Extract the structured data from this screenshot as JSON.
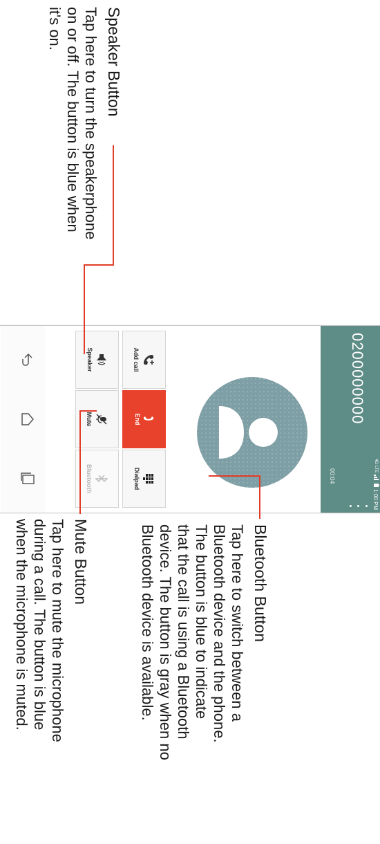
{
  "annotations": {
    "speaker": {
      "title": "Speaker Button",
      "body": [
        "Tap here to turn the speakerphone",
        "on or off. The button is blue when",
        "it's on."
      ]
    },
    "bluetooth": {
      "title": "Bluetooth Button",
      "body": [
        "Tap here to switch between a",
        "Bluetooth device and the phone.",
        "The button is blue to indicate",
        "that the call is using a Bluetooth",
        "device. The button is gray when no",
        "Bluetooth device is available."
      ]
    },
    "mute": {
      "title": "Mute Button",
      "body": [
        "Tap here to mute the microphone",
        "during a call. The button is blue",
        "when the microphone is muted."
      ]
    }
  },
  "phone": {
    "status_bar": {
      "network": "4G LTE",
      "time": "1:00 PM"
    },
    "call": {
      "number": "0200000000",
      "timer": "00:04"
    },
    "buttons": {
      "add_call": "Add call",
      "end": "End",
      "dialpad": "Dialpad",
      "speaker": "Speaker",
      "mute": "Mute",
      "bluetooth": "Bluetooth"
    },
    "icons": [
      "back-icon",
      "home-icon",
      "recent-apps-icon",
      "overflow-menu-icon",
      "phone-add-icon",
      "end-call-icon",
      "dialpad-icon",
      "speaker-icon",
      "mute-icon",
      "bluetooth-icon",
      "person-silhouette-icon"
    ],
    "colors": {
      "header": "#5e8c86",
      "end_button": "#e8412c",
      "leader_line": "#e23d28",
      "avatar": "#7e9fa5"
    }
  }
}
